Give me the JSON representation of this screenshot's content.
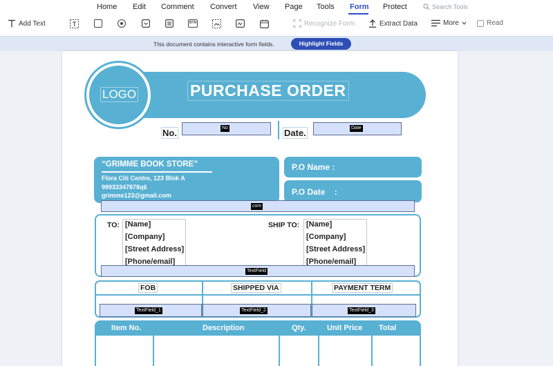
{
  "menu": {
    "items": [
      "Home",
      "Edit",
      "Comment",
      "Convert",
      "View",
      "Page",
      "Tools",
      "Form",
      "Protect"
    ],
    "active": "Form",
    "search_placeholder": "Search Tools"
  },
  "toolbar": {
    "add_text": "Add Text",
    "recognize_form": "Recognize Form",
    "extract_data": "Extract Data",
    "more": "More",
    "read": "Read",
    "icon_btn": "BTN"
  },
  "banner": {
    "message": "This document contains interactive form fields.",
    "button": "Highlight Fields"
  },
  "accent_color": "#58b0d3",
  "document": {
    "logo": "LOGO",
    "title": "PURCHASE ORDER",
    "no_label": "No.",
    "no_field": "No",
    "date_label": "Date.",
    "date_field": "Date",
    "store_name": "“GRIMME BOOK STORE”",
    "store_address": "Flora Citi Centre, 123 Blok A",
    "store_phone": "99933347878q6",
    "store_email": "grimme123@gmail.com",
    "po_name_label": "P.O Name :",
    "po_date_label": "P.O Date    :",
    "com_field": "com",
    "to_label": "TO:",
    "to_lines": [
      "[Name]",
      "[Company]",
      "[Street Address]",
      "[Phone/email]"
    ],
    "ship_label": "SHIP TO:",
    "ship_lines": [
      "[Name]",
      "[Company]",
      "[Street Address]",
      "[Phone/email]"
    ],
    "textfield": "TextField",
    "fob": "FOB",
    "shipped_via": "SHIPPED VIA",
    "payment_term": "PAYMENT TERM",
    "textfield_1": "TextField_1",
    "textfield_2": "TextField_2",
    "textfield_3": "TextField_3",
    "col_item": "Item No.",
    "col_desc": "Description",
    "col_qty": "Qty.",
    "col_price": "Unit Price",
    "col_total": "Total"
  }
}
